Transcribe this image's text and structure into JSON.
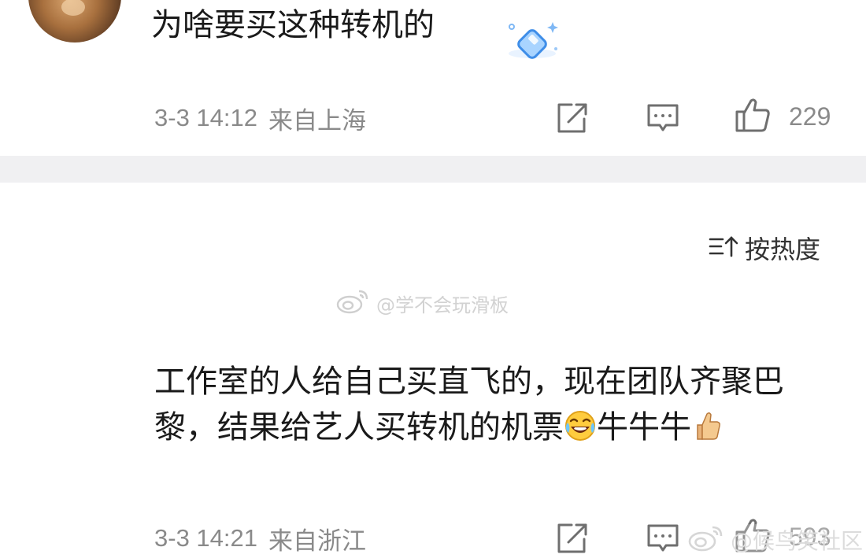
{
  "comments": [
    {
      "text": "为啥要买这种转机的",
      "time": "3-3 14:12",
      "location": "来自上海",
      "likes": "229"
    },
    {
      "text_parts": [
        "工作室的人给自己买直飞的，现在团队齐聚巴黎，结果给艺人买转机的机票",
        "牛牛牛"
      ],
      "time": "3-3 14:21",
      "location": "来自浙江",
      "likes": "593"
    }
  ],
  "sort": {
    "label": "按热度"
  },
  "watermarks": {
    "center": "@学不会玩滑板",
    "bottom_right": "@候鸟笑社区"
  },
  "icons": {
    "share": "share-icon",
    "comment": "comment-icon",
    "like": "thumbs-up-icon",
    "sort": "sort-icon",
    "laugh": "laughing-emoji",
    "thumbs": "thumbs-up-emoji",
    "sticker": "diamond-sticker"
  }
}
